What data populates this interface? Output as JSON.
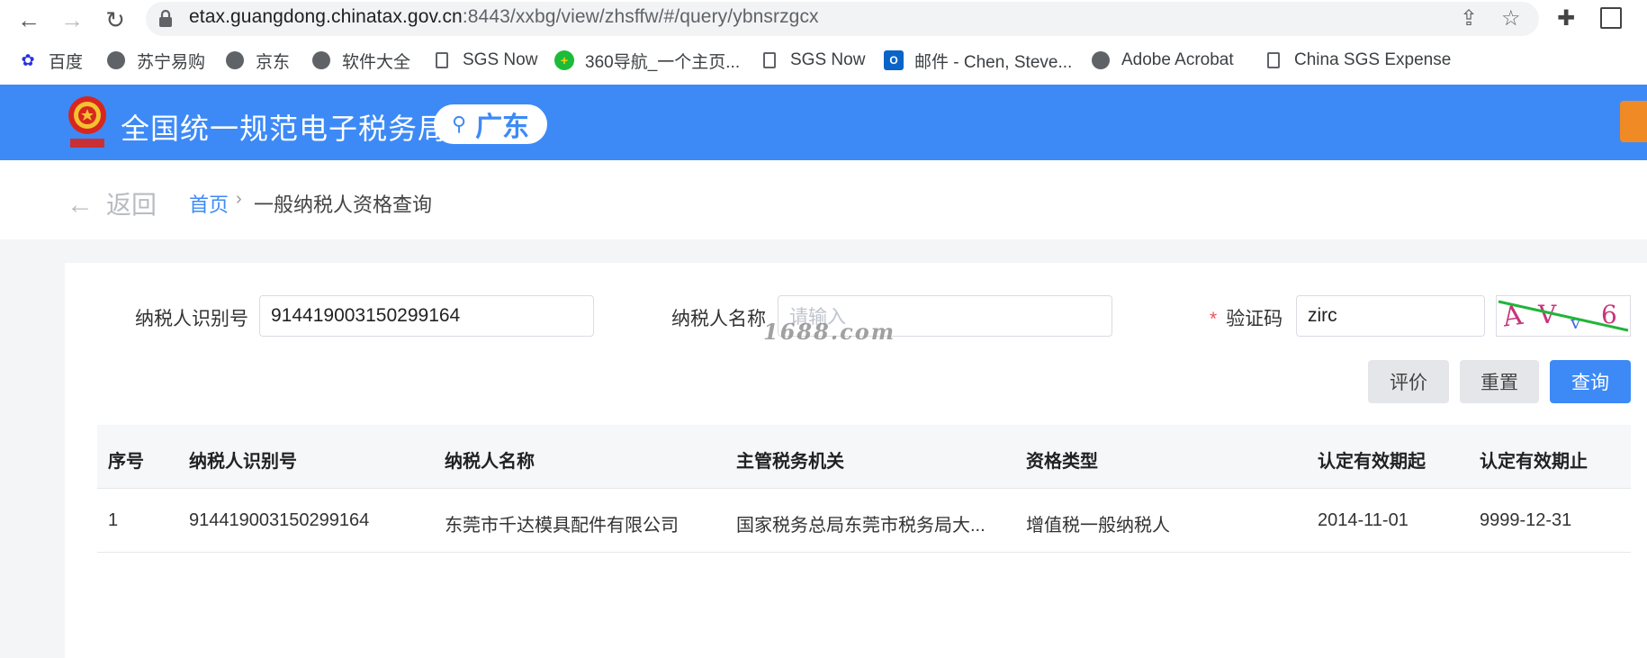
{
  "browser": {
    "url_host": "etax.guangdong.chinatax.gov.cn",
    "url_path": ":8443/xxbg/view/zhsffw/#/query/ybnsrzgcx",
    "bookmarks": [
      {
        "label": "百度",
        "icon": "baidu-icon"
      },
      {
        "label": "苏宁易购",
        "icon": "globe-icon"
      },
      {
        "label": "京东",
        "icon": "globe-icon"
      },
      {
        "label": "软件大全",
        "icon": "globe-icon"
      },
      {
        "label": "SGS Now",
        "icon": "document-icon"
      },
      {
        "label": "360导航_一个主页...",
        "icon": "360-icon"
      },
      {
        "label": "SGS Now",
        "icon": "document-icon"
      },
      {
        "label": "邮件 - Chen, Steve...",
        "icon": "outlook-icon"
      },
      {
        "label": "Adobe Acrobat",
        "icon": "globe-icon"
      },
      {
        "label": "China SGS Expense",
        "icon": "document-icon"
      }
    ]
  },
  "header": {
    "title": "全国统一规范电子税务局",
    "region": "广东",
    "brand_color": "#3d8af7"
  },
  "breadcrumb": {
    "back": "返回",
    "home": "首页",
    "separator": "›",
    "current": "一般纳税人资格查询"
  },
  "form": {
    "taxpayer_id_label": "纳税人识别号",
    "taxpayer_id_value": "914419003150299164",
    "taxpayer_name_label": "纳税人名称",
    "taxpayer_name_placeholder": "请输入",
    "captcha_required_mark": "*",
    "captcha_label": "验证码",
    "captcha_value": "zirc",
    "captcha_image_text": "AV6"
  },
  "watermark": "1688.com",
  "buttons": {
    "evaluate": "评价",
    "reset": "重置",
    "query": "查询"
  },
  "table": {
    "headers": [
      "序号",
      "纳税人识别号",
      "纳税人名称",
      "主管税务机关",
      "资格类型",
      "认定有效期起",
      "认定有效期止"
    ],
    "rows": [
      [
        "1",
        "914419003150299164",
        "东莞市千达模具配件有限公司",
        "国家税务总局东莞市税务局大...",
        "增值税一般纳税人",
        "2014-11-01",
        "9999-12-31"
      ]
    ]
  }
}
